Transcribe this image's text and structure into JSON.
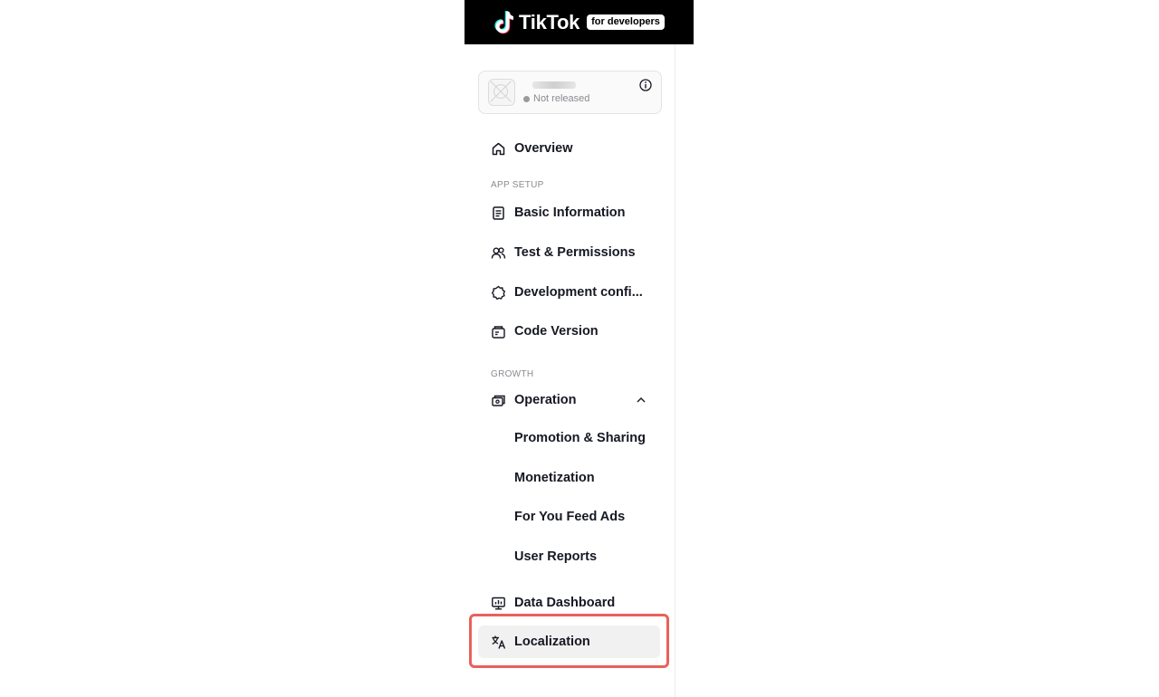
{
  "header": {
    "logo_text": "TikTok",
    "logo_badge": "for developers"
  },
  "app_card": {
    "status": "Not released"
  },
  "nav": {
    "overview": "Overview",
    "app_setup_section": "APP SETUP",
    "basic_information": "Basic Information",
    "test_permissions": "Test & Permissions",
    "development_config": "Development confi...",
    "code_version": "Code Version",
    "growth_section": "GROWTH",
    "operation": "Operation",
    "promotion_sharing": "Promotion & Sharing",
    "monetization": "Monetization",
    "for_you_feed_ads": "For You Feed Ads",
    "user_reports": "User Reports",
    "data_dashboard": "Data Dashboard",
    "localization": "Localization"
  },
  "colors": {
    "highlight_border": "#e9605c",
    "selected_bg": "#f1f1f2"
  }
}
